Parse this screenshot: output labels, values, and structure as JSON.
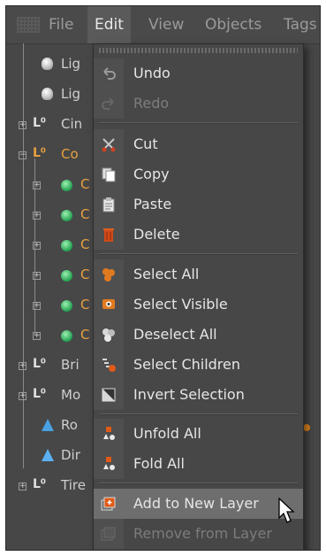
{
  "menubar": {
    "items": [
      {
        "label": "File"
      },
      {
        "label": "Edit"
      },
      {
        "label": "View"
      },
      {
        "label": "Objects"
      },
      {
        "label": "Tags"
      }
    ]
  },
  "tree": {
    "rows": [
      {
        "label": "Lig",
        "icon": "light-icon"
      },
      {
        "label": "Lig",
        "icon": "light-icon"
      },
      {
        "label": "Cin",
        "icon": "null-icon"
      },
      {
        "label": "Co",
        "icon": "null-icon"
      },
      {
        "label": "C",
        "icon": "sphere-icon"
      },
      {
        "label": "C",
        "icon": "sphere-icon"
      },
      {
        "label": "C",
        "icon": "sphere-icon"
      },
      {
        "label": "C",
        "icon": "sphere-icon"
      },
      {
        "label": "C",
        "icon": "sphere-icon"
      },
      {
        "label": "C",
        "icon": "sphere-icon"
      },
      {
        "label": "Bri",
        "icon": "null-icon"
      },
      {
        "label": "Mo",
        "icon": "null-icon"
      },
      {
        "label": "Ro",
        "icon": "rope-icon"
      },
      {
        "label": "Dir",
        "icon": "dir-icon"
      },
      {
        "label": "Tire",
        "icon": "null-icon"
      }
    ]
  },
  "context_menu": {
    "items": [
      {
        "label": "Undo",
        "icon": "undo-icon",
        "enabled": true
      },
      {
        "label": "Redo",
        "icon": "redo-icon",
        "enabled": false
      },
      {
        "label": "Cut",
        "icon": "scissors-icon",
        "enabled": true
      },
      {
        "label": "Copy",
        "icon": "copy-icon",
        "enabled": true
      },
      {
        "label": "Paste",
        "icon": "paste-icon",
        "enabled": true
      },
      {
        "label": "Delete",
        "icon": "trash-icon",
        "enabled": true
      },
      {
        "label": "Select All",
        "icon": "select-all-icon",
        "enabled": true
      },
      {
        "label": "Select Visible",
        "icon": "select-visible-icon",
        "enabled": true
      },
      {
        "label": "Deselect All",
        "icon": "deselect-all-icon",
        "enabled": true
      },
      {
        "label": "Select Children",
        "icon": "select-children-icon",
        "enabled": true
      },
      {
        "label": "Invert Selection",
        "icon": "invert-selection-icon",
        "enabled": true
      },
      {
        "label": "Unfold All",
        "icon": "unfold-all-icon",
        "enabled": true
      },
      {
        "label": "Fold All",
        "icon": "fold-all-icon",
        "enabled": true
      },
      {
        "label": "Add to New Layer",
        "icon": "add-layer-icon",
        "enabled": true
      },
      {
        "label": "Remove from Layer",
        "icon": "remove-layer-icon",
        "enabled": false
      }
    ]
  },
  "colors": {
    "panel_bg": "#474747",
    "menu_active": "#5a5a5a",
    "highlight": "#6e6e6e",
    "accent_orange": "#e8a040"
  }
}
